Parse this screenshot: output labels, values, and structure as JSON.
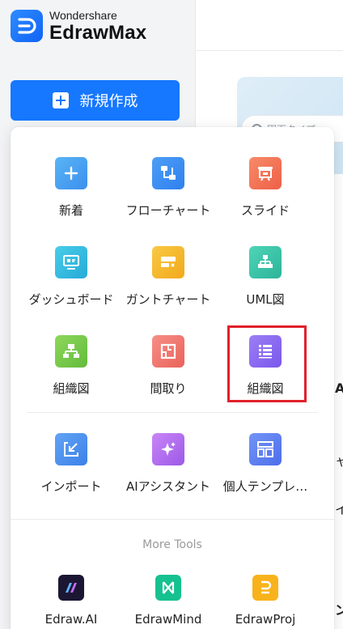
{
  "logo": {
    "sub": "Wondershare",
    "main": "EdrawMax"
  },
  "new_button": {
    "label": "新規作成"
  },
  "main": {
    "search_placeholder": "図面タイプ、",
    "fragments": [
      "A",
      "ャ",
      "イ",
      "ン"
    ]
  },
  "menu": {
    "rows": [
      [
        {
          "label": "新着",
          "icon": "plus-icon",
          "color": "#4aa3f0"
        },
        {
          "label": "フローチャート",
          "icon": "flowchart-icon",
          "color": "#3d8ff0"
        },
        {
          "label": "スライド",
          "icon": "slide-icon",
          "color": "#f07158"
        }
      ],
      [
        {
          "label": "ダッシュボード",
          "icon": "dashboard-icon",
          "color": "#35b9e0"
        },
        {
          "label": "ガントチャート",
          "icon": "gantt-icon",
          "color": "#f5b82e"
        },
        {
          "label": "UML図",
          "icon": "uml-icon",
          "color": "#3cc4aa"
        }
      ],
      [
        {
          "label": "組織図",
          "icon": "org-chart-icon",
          "color": "#7fcd4d"
        },
        {
          "label": "間取り",
          "icon": "floor-plan-icon",
          "color": "#f37b73"
        },
        {
          "label": "組織図",
          "icon": "list-icon",
          "color": "#8b69f0"
        }
      ],
      [
        {
          "label": "インポート",
          "icon": "import-icon",
          "color": "#4f92ee"
        },
        {
          "label": "AIアシスタント",
          "icon": "sparkle-icon",
          "color": "#b26af0"
        },
        {
          "label": "個人テンプレ…",
          "icon": "template-icon",
          "color": "#5d7ef0"
        }
      ]
    ],
    "more_tools_label": "More Tools",
    "tools": [
      {
        "label": "Edraw.AI",
        "icon": "edraw-ai-icon"
      },
      {
        "label": "EdrawMind",
        "icon": "edrawmind-icon"
      },
      {
        "label": "EdrawProj",
        "icon": "edrawproj-icon"
      }
    ]
  }
}
